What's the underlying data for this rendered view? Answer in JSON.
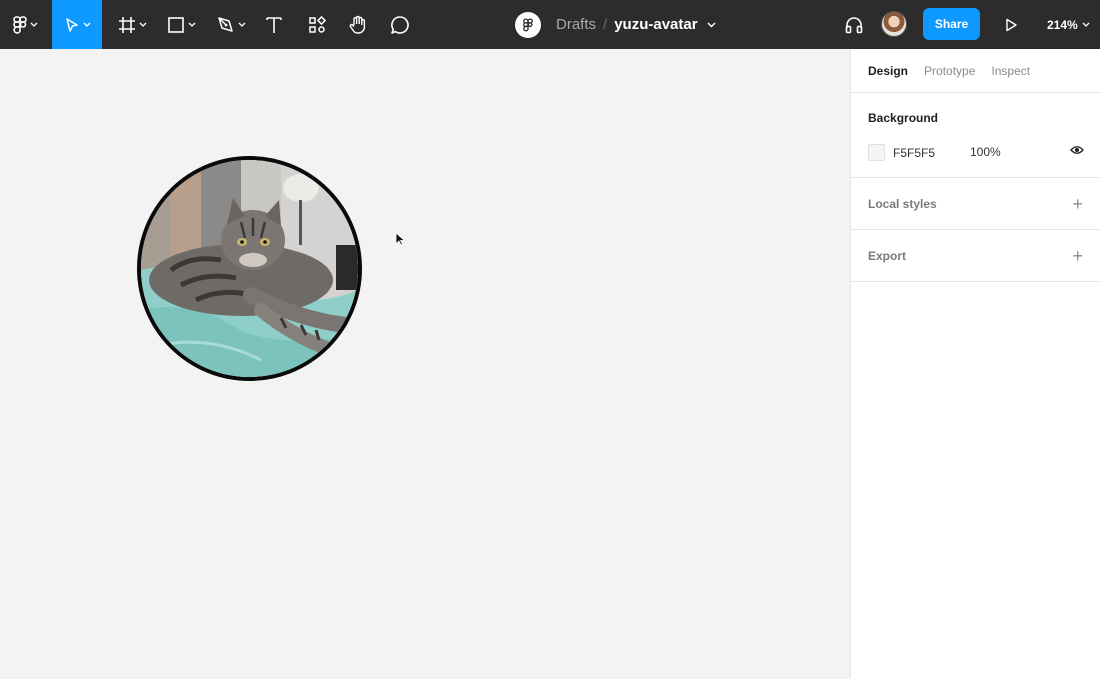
{
  "toolbar": {
    "background_color": "#2c2c2c",
    "accent_color": "#0d99ff",
    "tools": [
      {
        "name": "main-menu",
        "icon": "figma-logo-icon"
      },
      {
        "name": "move-tool",
        "icon": "cursor-arrow-icon",
        "active": true
      },
      {
        "name": "frame-tool",
        "icon": "hash-frame-icon"
      },
      {
        "name": "shape-tool",
        "icon": "rectangle-icon"
      },
      {
        "name": "pen-tool",
        "icon": "pen-nib-icon"
      },
      {
        "name": "text-tool",
        "icon": "text-t-icon"
      },
      {
        "name": "resources-tool",
        "icon": "components-icon"
      },
      {
        "name": "hand-tool",
        "icon": "hand-icon"
      },
      {
        "name": "comment-tool",
        "icon": "speech-bubble-icon"
      }
    ]
  },
  "breadcrumb": {
    "drafts": "Drafts",
    "separator": "/",
    "file_name": "yuzu-avatar"
  },
  "header_right": {
    "audio_icon": "headphones-icon",
    "share_label": "Share",
    "present_icon": "play-triangle-icon",
    "zoom": "214%"
  },
  "canvas": {
    "background_color": "#f3f3f3",
    "content": "circular avatar image of a tabby cat lying on a teal blanket"
  },
  "panel": {
    "tabs": [
      {
        "label": "Design",
        "active": true
      },
      {
        "label": "Prototype",
        "active": false
      },
      {
        "label": "Inspect",
        "active": false
      }
    ],
    "background": {
      "title": "Background",
      "hex": "F5F5F5",
      "swatch_color": "#f5f5f5",
      "opacity": "100%"
    },
    "local_styles": {
      "title": "Local styles",
      "add": "+"
    },
    "export": {
      "title": "Export",
      "add": "+"
    }
  }
}
